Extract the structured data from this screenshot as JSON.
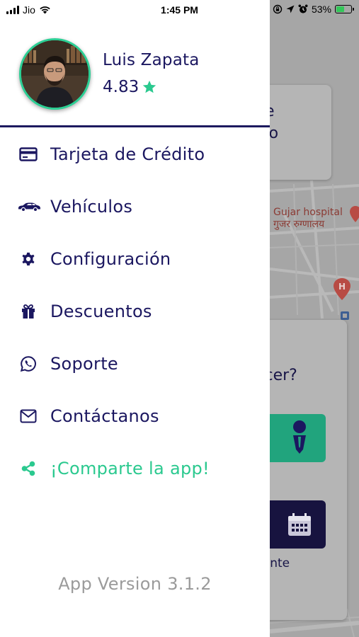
{
  "status_bar": {
    "carrier": "Jio",
    "time": "1:45 PM",
    "battery_percent": "53%",
    "battery_level": 0.53,
    "icons": [
      "signal-icon",
      "wifi-icon",
      "screen-lock-icon",
      "location-icon",
      "alarm-icon",
      "battery-charging-icon"
    ]
  },
  "drawer": {
    "user": {
      "name": "Luis Zapata",
      "rating": "4.83",
      "rating_icon": "star-icon"
    },
    "menu": [
      {
        "label": "Tarjeta de Crédito",
        "icon": "credit-card-icon"
      },
      {
        "label": "Vehículos",
        "icon": "car-icon"
      },
      {
        "label": "Configuración",
        "icon": "gear-icon"
      },
      {
        "label": "Descuentos",
        "icon": "gift-icon"
      },
      {
        "label": "Soporte",
        "icon": "whatsapp-icon"
      },
      {
        "label": "Contáctanos",
        "icon": "envelope-icon"
      },
      {
        "label": "¡Comparte la app!",
        "icon": "share-icon"
      }
    ],
    "version": "App Version 3.1.2"
  },
  "background": {
    "card_text_line1": "de",
    "card_text_line2": "alo",
    "hospital_name": "Gujar hospital",
    "hospital_name_local": "गुजर रुग्णालय",
    "question_text": "acer?",
    "bottom_label": "nente"
  },
  "colors": {
    "brand_navy": "#1b1760",
    "brand_green": "#2bc98f",
    "version_gray": "#9b9b9b"
  }
}
